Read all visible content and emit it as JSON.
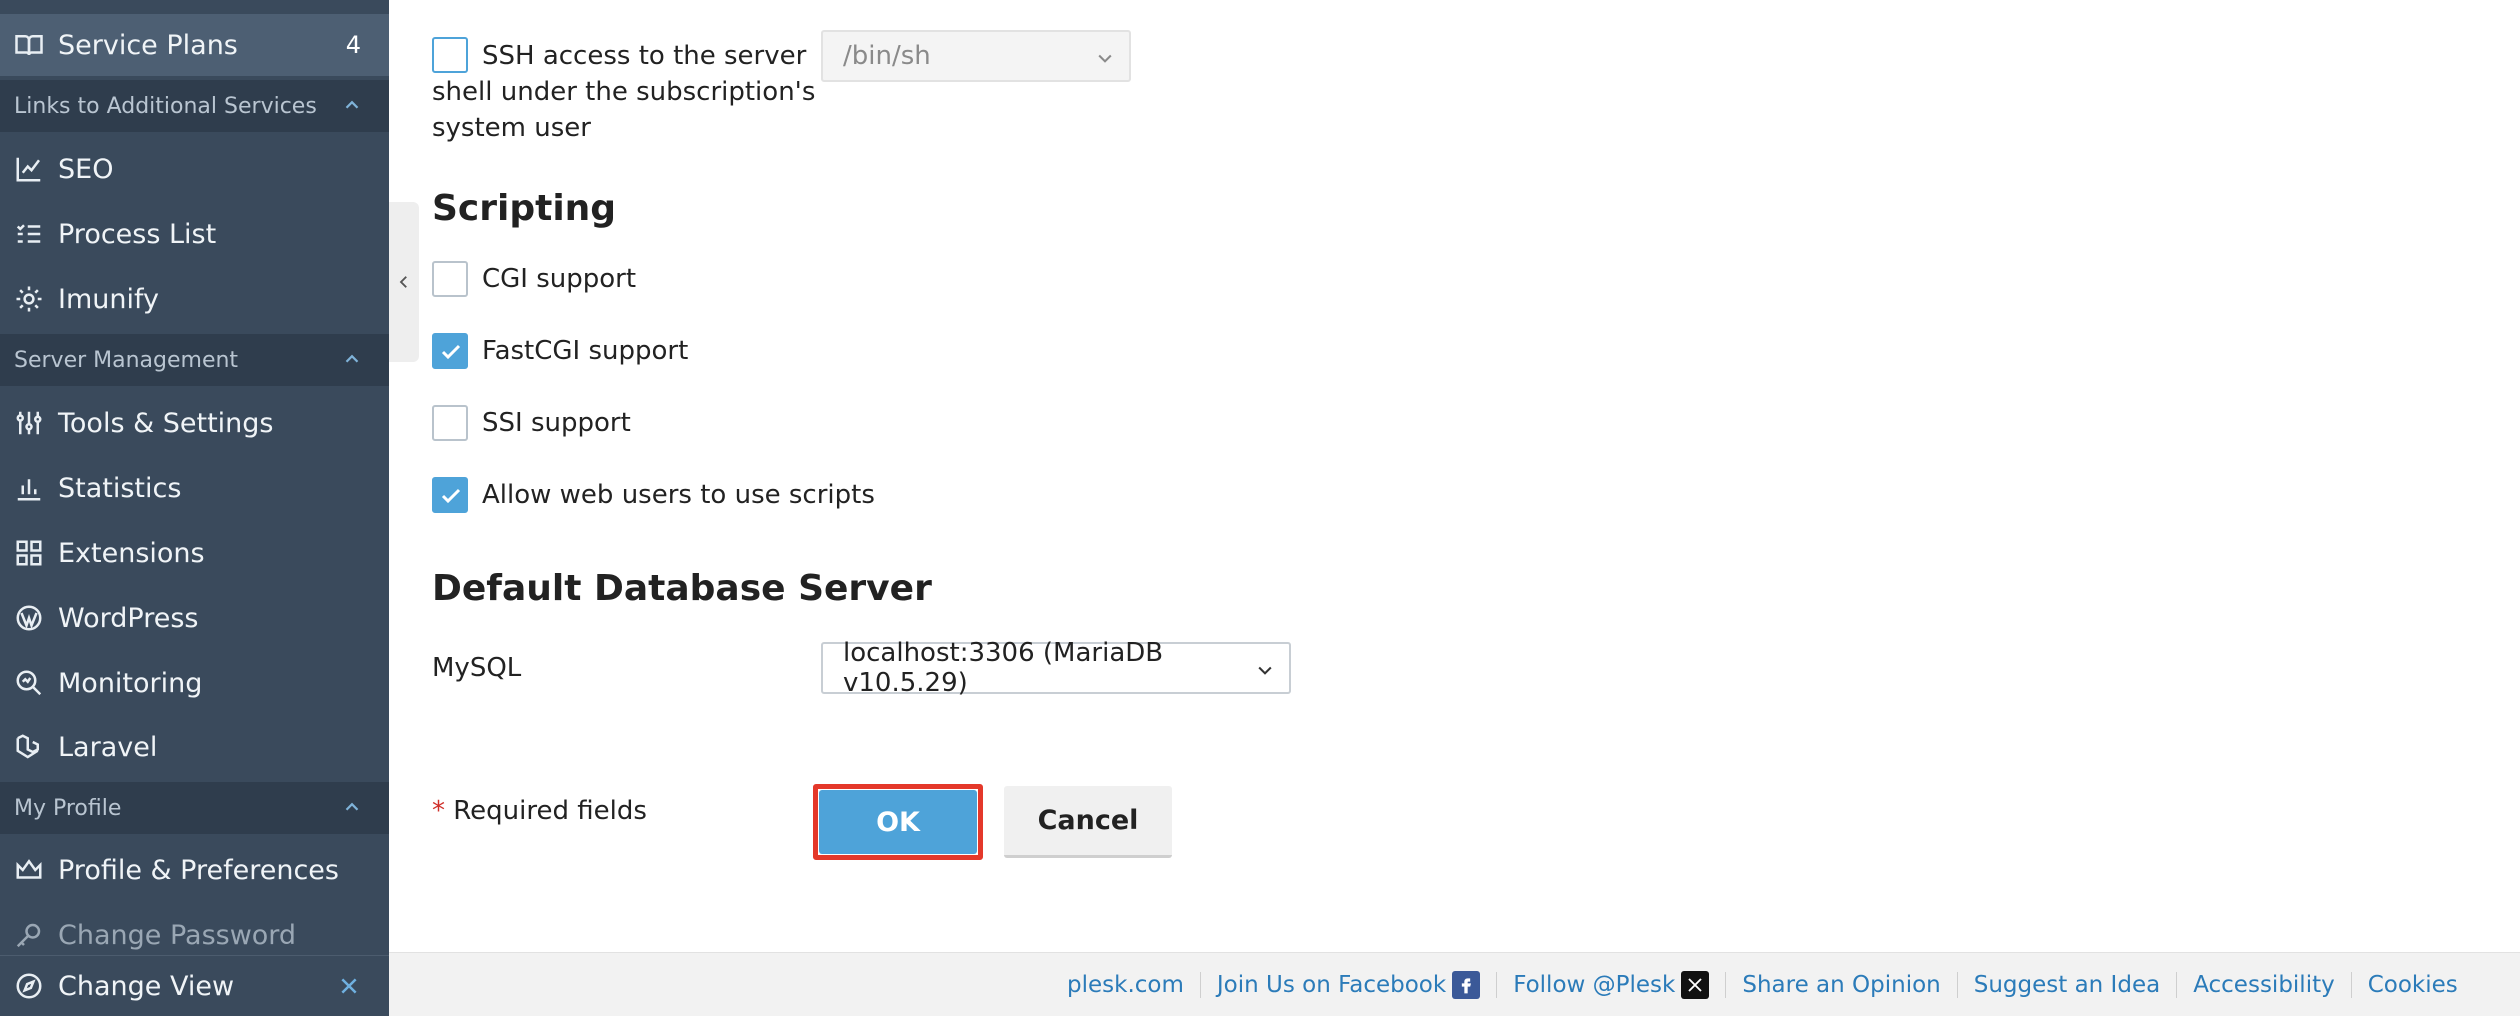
{
  "sidebar": {
    "service_plans": {
      "label": "Service Plans",
      "count": "4"
    },
    "sections": {
      "links": "Links to Additional Services",
      "server": "Server Management",
      "profile": "My Profile"
    },
    "items": {
      "seo": "SEO",
      "process_list": "Process List",
      "imunify": "Imunify",
      "tools": "Tools & Settings",
      "statistics": "Statistics",
      "extensions": "Extensions",
      "wordpress": "WordPress",
      "monitoring": "Monitoring",
      "laravel": "Laravel",
      "profile_prefs": "Profile & Preferences",
      "change_password": "Change Password"
    },
    "change_view": "Change View"
  },
  "main": {
    "ssh": {
      "label_line1": "SSH access to the server",
      "label_line2": "shell under the subscription's",
      "label_line3": "system user",
      "shell_value": "/bin/sh"
    },
    "scripting": {
      "heading": "Scripting",
      "cgi": "CGI support",
      "fastcgi": "FastCGI support",
      "ssi": "SSI support",
      "web_scripts": "Allow web users to use scripts"
    },
    "database": {
      "heading": "Default Database Server",
      "mysql_label": "MySQL",
      "mysql_value": "localhost:3306 (MariaDB v10.5.29)"
    },
    "required": {
      "star": "*",
      "text": " Required fields"
    },
    "buttons": {
      "ok": "OK",
      "cancel": "Cancel"
    }
  },
  "footer": {
    "plesk": "plesk.com",
    "facebook": "Join Us on Facebook",
    "follow": "Follow @Plesk",
    "opinion": "Share an Opinion",
    "idea": "Suggest an Idea",
    "accessibility": "Accessibility",
    "cookies": "Cookies"
  },
  "colors": {
    "sidebar_bg": "#3a4a5c",
    "section_bg": "#2f3d4d",
    "accent": "#4ea3d9",
    "highlight": "#e4382a",
    "link": "#2b7bb9"
  }
}
